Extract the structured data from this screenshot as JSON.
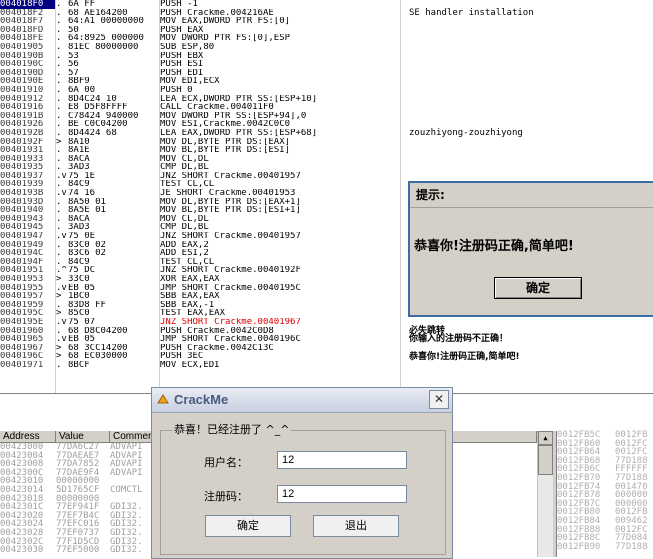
{
  "cpu": {
    "selected_index": 0,
    "rows": [
      {
        "addr": "004018F0",
        "m": ".",
        "hex": "6A FF",
        "asm": "PUSH -1"
      },
      {
        "addr": "004018F2",
        "m": ".",
        "hex": "68 AE164200",
        "asm": "PUSH Crackme.004216AE"
      },
      {
        "addr": "004018F7",
        "m": ".",
        "hex": "64:A1 00000000",
        "asm": "MOV EAX,DWORD PTR FS:[0]"
      },
      {
        "addr": "004018FD",
        "m": ".",
        "hex": "50",
        "asm": "PUSH EAX"
      },
      {
        "addr": "004018FE",
        "m": ".",
        "hex": "64:8925 000000",
        "asm": "MOV DWORD PTR FS:[0],ESP"
      },
      {
        "addr": "00401905",
        "m": ".",
        "hex": "81EC 80000000",
        "asm": "SUB ESP,80"
      },
      {
        "addr": "0040190B",
        "m": ".",
        "hex": "53",
        "asm": "PUSH EBX"
      },
      {
        "addr": "0040190C",
        "m": ".",
        "hex": "56",
        "asm": "PUSH ESI"
      },
      {
        "addr": "0040190D",
        "m": ".",
        "hex": "57",
        "asm": "PUSH EDI"
      },
      {
        "addr": "0040190E",
        "m": ".",
        "hex": "8BF9",
        "asm": "MOV EDI,ECX"
      },
      {
        "addr": "00401910",
        "m": ".",
        "hex": "6A 00",
        "asm": "PUSH 0"
      },
      {
        "addr": "00401912",
        "m": ".",
        "hex": "8D4C24 10",
        "asm": "LEA ECX,DWORD PTR SS:[ESP+10]"
      },
      {
        "addr": "00401916",
        "m": ".",
        "hex": "E8 D5F8FFFF",
        "asm": "CALL Crackme.004011F0"
      },
      {
        "addr": "0040191B",
        "m": ".",
        "hex": "C78424 940000",
        "asm": "MOV DWORD PTR SS:[ESP+94],0"
      },
      {
        "addr": "00401926",
        "m": ".",
        "hex": "BE C0C04200",
        "asm": "MOV ESI,Crackme.0042C0C0"
      },
      {
        "addr": "0040192B",
        "m": ".",
        "hex": "8D4424 68",
        "asm": "LEA EAX,DWORD PTR SS:[ESP+68]"
      },
      {
        "addr": "0040192F",
        "m": ">",
        "hex": "8A10",
        "asm": "MOV DL,BYTE PTR DS:[EAX]"
      },
      {
        "addr": "00401931",
        "m": ".",
        "hex": "8A1E",
        "asm": "MOV BL,BYTE PTR DS:[ESI]"
      },
      {
        "addr": "00401933",
        "m": ".",
        "hex": "8ACA",
        "asm": "MOV CL,DL"
      },
      {
        "addr": "00401935",
        "m": ".",
        "hex": "3AD3",
        "asm": "CMP DL,BL"
      },
      {
        "addr": "00401937",
        "m": ".v",
        "hex": "75 1E",
        "asm": "JNZ SHORT Crackme.00401957"
      },
      {
        "addr": "00401939",
        "m": ".",
        "hex": "84C9",
        "asm": "TEST CL,CL"
      },
      {
        "addr": "0040193B",
        "m": ".v",
        "hex": "74 16",
        "asm": "JE SHORT Crackme.00401953"
      },
      {
        "addr": "0040193D",
        "m": ".",
        "hex": "8A50 01",
        "asm": "MOV DL,BYTE PTR DS:[EAX+1]"
      },
      {
        "addr": "00401940",
        "m": ".",
        "hex": "8A5E 01",
        "asm": "MOV BL,BYTE PTR DS:[ESI+1]"
      },
      {
        "addr": "00401943",
        "m": ".",
        "hex": "8ACA",
        "asm": "MOV CL,DL"
      },
      {
        "addr": "00401945",
        "m": ".",
        "hex": "3AD3",
        "asm": "CMP DL,BL"
      },
      {
        "addr": "00401947",
        "m": ".v",
        "hex": "75 0E",
        "asm": "JNZ SHORT Crackme.00401957"
      },
      {
        "addr": "00401949",
        "m": ".",
        "hex": "83C0 02",
        "asm": "ADD EAX,2"
      },
      {
        "addr": "0040194C",
        "m": ".",
        "hex": "83C6 02",
        "asm": "ADD ESI,2"
      },
      {
        "addr": "0040194F",
        "m": ".",
        "hex": "84C9",
        "asm": "TEST CL,CL"
      },
      {
        "addr": "00401951",
        "m": ".^",
        "hex": "75 DC",
        "asm": "JNZ SHORT Crackme.0040192F"
      },
      {
        "addr": "00401953",
        "m": ">",
        "hex": "33C0",
        "asm": "XOR EAX,EAX"
      },
      {
        "addr": "00401955",
        "m": ".v",
        "hex": "EB 05",
        "asm": "JMP SHORT Crackme.0040195C"
      },
      {
        "addr": "00401957",
        "m": ">",
        "hex": "1BC0",
        "asm": "SBB EAX,EAX"
      },
      {
        "addr": "00401959",
        "m": ".",
        "hex": "83D8 FF",
        "asm": "SBB EAX,-1"
      },
      {
        "addr": "0040195C",
        "m": ">",
        "hex": "85C0",
        "asm": "TEST EAX,EAX"
      },
      {
        "addr": "0040195E",
        "m": ".v",
        "hex": "75 07",
        "asm": "JNZ SHORT Crackme.00401967",
        "red": true
      },
      {
        "addr": "00401960",
        "m": ".",
        "hex": "68 D8C04200",
        "asm": "PUSH Crackme.0042C0D8"
      },
      {
        "addr": "00401965",
        "m": ".v",
        "hex": "EB 05",
        "asm": "JMP SHORT Crackme.0040196C"
      },
      {
        "addr": "00401967",
        "m": ">",
        "hex": "68 3CC14200",
        "asm": "PUSH Crackme.0042C13C"
      },
      {
        "addr": "0040196C",
        "m": ">",
        "hex": "68 EC030000",
        "asm": "PUSH 3EC"
      },
      {
        "addr": "00401971",
        "m": ".",
        "hex": "8BCF",
        "asm": "MOV ECX,EDI"
      }
    ],
    "comments": [
      {
        "row": 1,
        "text": "SE handler installation"
      },
      {
        "row": 15,
        "text": "zouzhiyong-zouzhiyong"
      },
      {
        "row": 38,
        "text": "必失跳转"
      },
      {
        "row": 39,
        "text": "你输入的注册码不正确！"
      },
      {
        "row": 41,
        "text": "恭喜你!注册码正确,简单吧!"
      }
    ]
  },
  "dump": {
    "headers": [
      "Address",
      "Value",
      "Comment"
    ],
    "rows": [
      {
        "addr": "00423000",
        "val": "77DA6C27",
        "cmt": "ADVAPI"
      },
      {
        "addr": "00423004",
        "val": "77DAEAE7",
        "cmt": "ADVAPI"
      },
      {
        "addr": "00423008",
        "val": "77DA7852",
        "cmt": "ADVAPI"
      },
      {
        "addr": "0042300C",
        "val": "77DAE9F4",
        "cmt": "ADVAPI"
      },
      {
        "addr": "00423010",
        "val": "00000000",
        "cmt": ""
      },
      {
        "addr": "00423014",
        "val": "5D1765CF",
        "cmt": "COMCTL"
      },
      {
        "addr": "00423018",
        "val": "00000000",
        "cmt": ""
      },
      {
        "addr": "0042301C",
        "val": "77EF941F",
        "cmt": "GDI32."
      },
      {
        "addr": "00423020",
        "val": "77EF7B4C",
        "cmt": "GDI32."
      },
      {
        "addr": "00423024",
        "val": "77EFC016",
        "cmt": "GDI32."
      },
      {
        "addr": "00423028",
        "val": "77EF0737",
        "cmt": "GDI32."
      },
      {
        "addr": "0042302C",
        "val": "77F1D5CD",
        "cmt": "GDI32."
      },
      {
        "addr": "00423030",
        "val": "77EF5000",
        "cmt": "GDI32."
      }
    ]
  },
  "stack": {
    "rows": [
      {
        "addr": "0012FB5C",
        "val": "0012FB"
      },
      {
        "addr": "0012FB60",
        "val": "0012FC"
      },
      {
        "addr": "0012FB64",
        "val": "0012FC"
      },
      {
        "addr": "0012FB68",
        "val": "77D188"
      },
      {
        "addr": "0012FB6C",
        "val": "FFFFFF"
      },
      {
        "addr": "0012FB70",
        "val": "77D188"
      },
      {
        "addr": "0012FB74",
        "val": "001470"
      },
      {
        "addr": "0012FB78",
        "val": "000000"
      },
      {
        "addr": "0012FB7C",
        "val": "000000"
      },
      {
        "addr": "0012FB80",
        "val": "0012FB"
      },
      {
        "addr": "0012FB84",
        "val": "009462"
      },
      {
        "addr": "0012FB88",
        "val": "0012FC"
      },
      {
        "addr": "0012FB8C",
        "val": "77D084"
      },
      {
        "addr": "0012FB90",
        "val": "77D188"
      }
    ]
  },
  "msgbox": {
    "title": "提示:",
    "message": "恭喜你!注册码正确,简单吧!",
    "ok_label": "确定"
  },
  "crackme": {
    "title": "CrackMe",
    "close_glyph": "✕",
    "group_label": "恭喜！已经注册了 ^_^",
    "username_label": "用户名：",
    "username_value": "12",
    "code_label": "注册码：",
    "code_value": "12",
    "ok_label": "确定",
    "exit_label": "退出"
  }
}
